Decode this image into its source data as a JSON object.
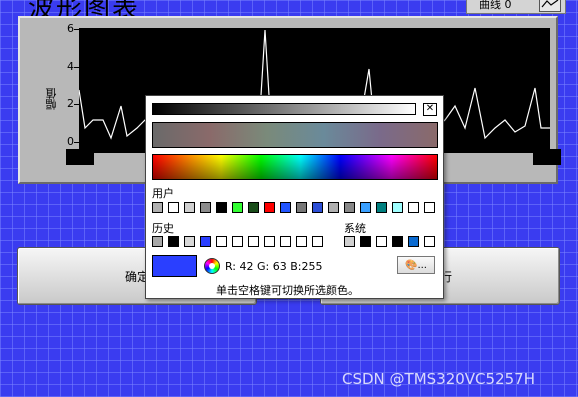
{
  "window": {
    "title": "波形图表"
  },
  "legend": {
    "curve_label": "曲线 0"
  },
  "chart": {
    "ylabel": "幅值",
    "yticks": [
      "6",
      "4",
      "2",
      "0"
    ],
    "background": "#000000",
    "line_color": "#ffffff"
  },
  "buttons": {
    "ok_label": "确定",
    "run_label": "运行"
  },
  "color_picker": {
    "user_label": "用户",
    "history_label": "历史",
    "system_label": "系统",
    "rgb_text": "R: 42 G: 63 B:255",
    "hint": "单击空格键可切换所选颜色。",
    "selected_color": "#2a3fff",
    "palette_button": "...",
    "user_colors": [
      "#b0b0b0",
      "#ffffff",
      "#d0d0d0",
      "#8c8c8c",
      "#000000",
      "#33ff33",
      "#1a4d1a",
      "#ff0000",
      "#2255ff",
      "#777777",
      "#2d4fd6",
      "#b0b0b0",
      "#888888",
      "#3aa0ff",
      "#008080",
      "#a0ffff",
      "#ffffff",
      "#ffffff"
    ],
    "history_colors": [
      "#a8a8a8",
      "#000000",
      "#d8d8d8",
      "#2a3fff",
      "#ffffff",
      "#ffffff",
      "#ffffff",
      "#ffffff",
      "#ffffff",
      "#ffffff",
      "#ffffff"
    ],
    "system_colors": [
      "#d0d0d0",
      "#000000",
      "#ffffff",
      "#000000",
      "#0a6ad0",
      "#ffffff"
    ]
  },
  "watermark": "CSDN @TMS320VC5257H"
}
